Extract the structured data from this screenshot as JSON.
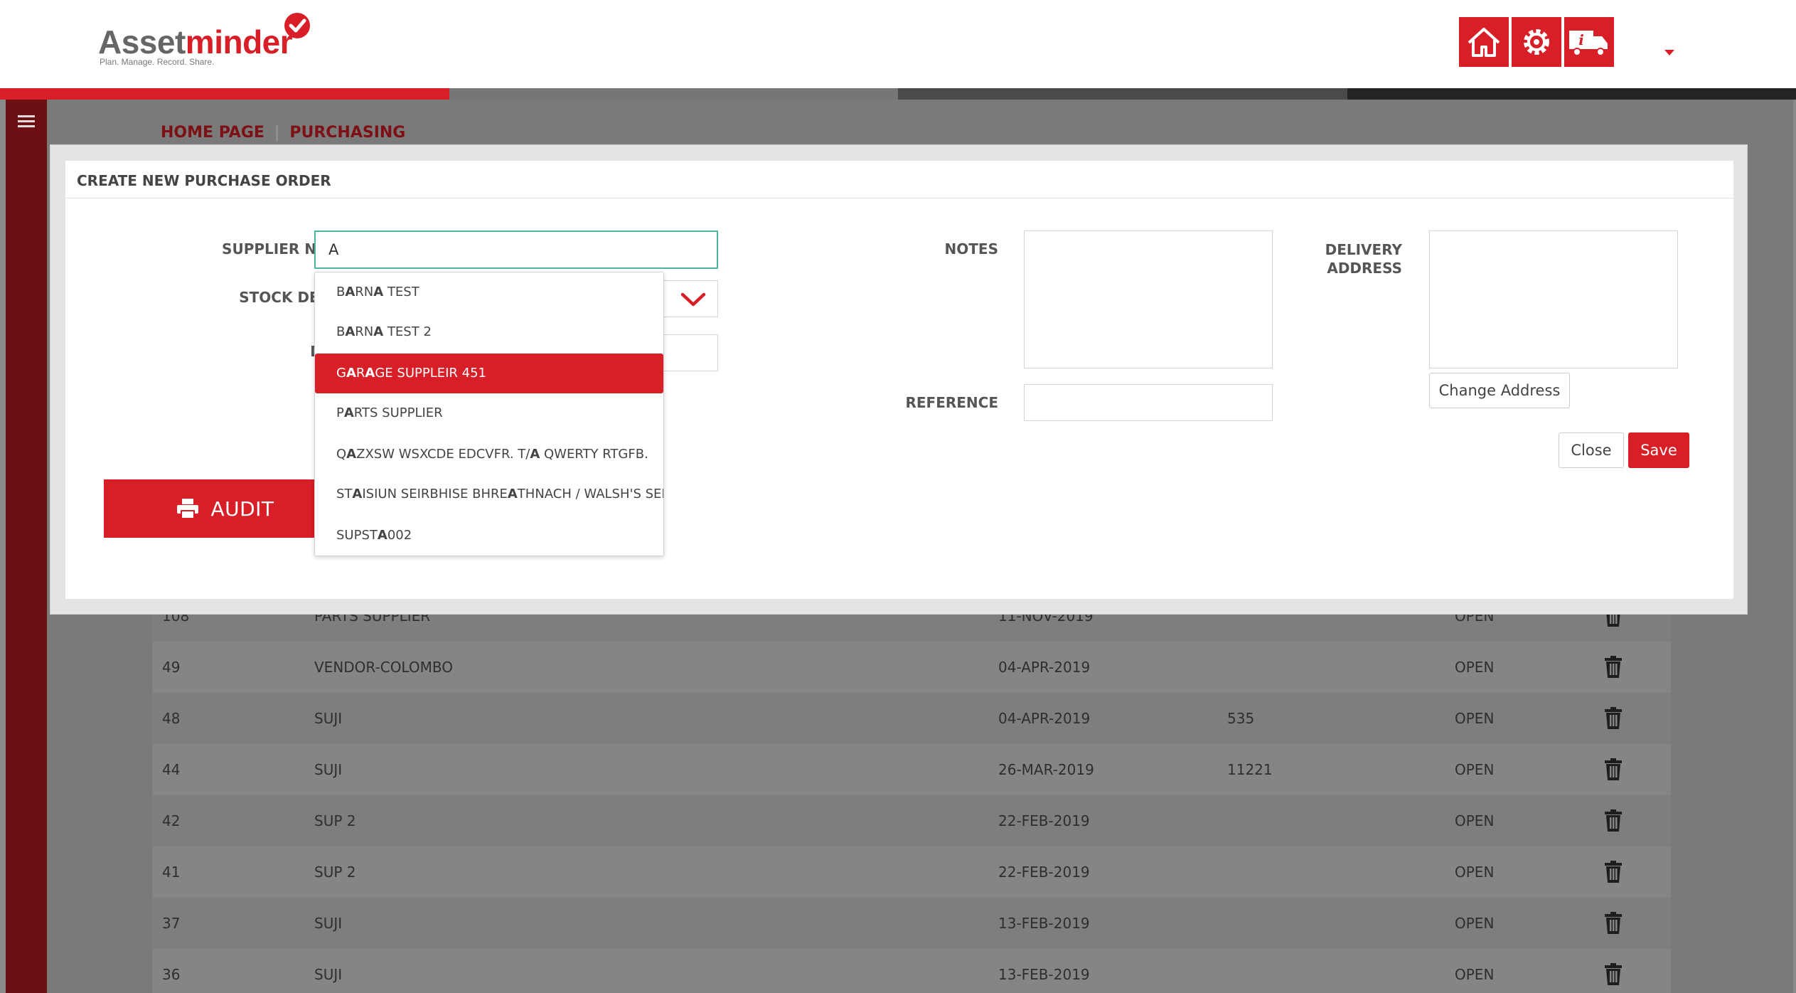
{
  "brand": {
    "name_part1": "Asset",
    "name_part2": "minder",
    "tagline": "Plan. Manage. Record. Share.",
    "accent_color": "#d81e26"
  },
  "header": {
    "icons": [
      "home-icon",
      "settings-gear-icon",
      "truck-info-icon"
    ],
    "progress_colors": [
      "#d81e26",
      "#767676",
      "#4a4a4a",
      "#252525"
    ]
  },
  "breadcrumb": {
    "home": "HOME PAGE",
    "separator": "|",
    "current": "PURCHASING"
  },
  "modal": {
    "title": "CREATE NEW PURCHASE ORDER",
    "supplier_label": "SUPPLIER NAME",
    "supplier_value": "A",
    "stock_depot_label": "STOCK DEPOT",
    "date_label": "DATE",
    "notes_label": "NOTES",
    "reference_label": "REFERENCE",
    "delivery_label_line1": "DELIVERY",
    "delivery_label_line2": "ADDRESS",
    "change_address": "Change Address",
    "close": "Close",
    "save": "Save",
    "audit": "AUDIT"
  },
  "dropdown": {
    "items": [
      {
        "pre": "B",
        "match": "A",
        "post": "RN",
        "match2": "A",
        "rest": " TEST",
        "selected": false
      },
      {
        "pre": "B",
        "match": "A",
        "post": "RN",
        "match2": "A",
        "rest": " TEST 2",
        "selected": false
      },
      {
        "pre": "G",
        "match": "A",
        "post": "R",
        "match2": "A",
        "rest": "GE SUPPLEIR 451",
        "selected": true
      },
      {
        "pre": "P",
        "match": "A",
        "post": "RTS SUPPLIER",
        "match2": "",
        "rest": "",
        "selected": false
      },
      {
        "pre": "Q",
        "match": "A",
        "post": "ZXSW WSXCDE EDCVFR. T/",
        "match2": "A",
        "rest": " QWERTY RTGFB.",
        "selected": false
      },
      {
        "pre": "ST",
        "match": "A",
        "post": "ISIUN SEIRBHISE BHRE",
        "match2": "A",
        "rest": "THNACH / WALSH'S SER",
        "selected": false
      },
      {
        "pre": "SUPST",
        "match": "A",
        "post": "002",
        "match2": "",
        "rest": "",
        "selected": false
      }
    ]
  },
  "table": {
    "rows": [
      {
        "id": "108",
        "supplier": "PARTS SUPPLIER",
        "date": "11-NOV-2019",
        "ref": "",
        "status": "OPEN"
      },
      {
        "id": "49",
        "supplier": "VENDOR-COLOMBO",
        "date": "04-APR-2019",
        "ref": "",
        "status": "OPEN"
      },
      {
        "id": "48",
        "supplier": "SUJI",
        "date": "04-APR-2019",
        "ref": "535",
        "status": "OPEN"
      },
      {
        "id": "44",
        "supplier": "SUJI",
        "date": "26-MAR-2019",
        "ref": "11221",
        "status": "OPEN"
      },
      {
        "id": "42",
        "supplier": "SUP 2",
        "date": "22-FEB-2019",
        "ref": "",
        "status": "OPEN"
      },
      {
        "id": "41",
        "supplier": "SUP 2",
        "date": "22-FEB-2019",
        "ref": "",
        "status": "OPEN"
      },
      {
        "id": "37",
        "supplier": "SUJI",
        "date": "13-FEB-2019",
        "ref": "",
        "status": "OPEN"
      },
      {
        "id": "36",
        "supplier": "SUJI",
        "date": "13-FEB-2019",
        "ref": "",
        "status": "OPEN"
      }
    ]
  }
}
